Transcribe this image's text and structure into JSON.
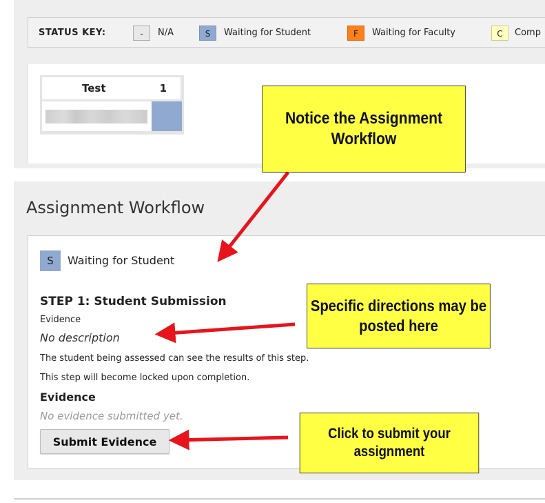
{
  "status_key": {
    "label": "STATUS KEY:",
    "items": [
      {
        "code": "-",
        "text": "N/A",
        "color": "#e8e8e8"
      },
      {
        "code": "S",
        "text": "Waiting for Student",
        "color": "#8fa9d0"
      },
      {
        "code": "F",
        "text": "Waiting for Faculty",
        "color": "#ff7f1a"
      },
      {
        "code": "C",
        "text": "Comp",
        "color": "#ffffc2"
      }
    ]
  },
  "test_widget": {
    "name": "Test",
    "count": "1",
    "cell_color": "#8fa9d0"
  },
  "workflow": {
    "title": "Assignment Workflow",
    "status_code": "S",
    "status_text": "Waiting for Student",
    "step_title": "STEP 1: Student Submission",
    "step_subtitle": "Evidence",
    "description": "No description",
    "note_visibility": "The student being assessed can see the results of this step.",
    "note_lock": "This step will become locked upon completion.",
    "evidence_heading": "Evidence",
    "evidence_empty": "No evidence submitted yet.",
    "submit_label": "Submit Evidence"
  },
  "callouts": {
    "workflow": "Notice the Assignment Workflow",
    "directions": "Specific directions may be posted here",
    "submit": "Click to submit your assignment"
  },
  "colors": {
    "callout_bg": "#ffff44",
    "arrow": "#e8141c",
    "panel_bg": "#eeeeee"
  }
}
